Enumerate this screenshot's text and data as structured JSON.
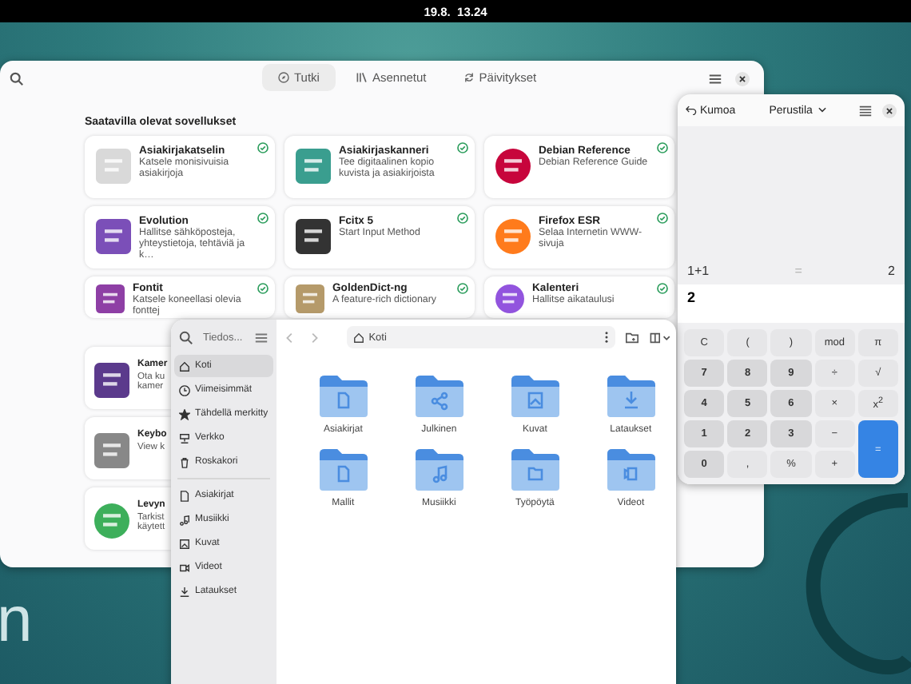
{
  "top_bar": {
    "clock": "19.8.  13.24"
  },
  "wallpaper": {
    "text": "n"
  },
  "software": {
    "tabs": [
      {
        "label": "Tutki",
        "selected": true
      },
      {
        "label": "Asennetut",
        "selected": false
      },
      {
        "label": "Päivitykset",
        "selected": false
      }
    ],
    "section_title": "Saatavilla olevat sovellukset",
    "apps": [
      {
        "name": "Asiakirjakatselin",
        "description": "Katsele monisivuisia asiakirjoja",
        "installed": true
      },
      {
        "name": "Asiakirjaskanneri",
        "description": "Tee digitaalinen kopio kuvista ja asiakirjoista",
        "installed": true
      },
      {
        "name": "Debian Reference",
        "description": "Debian Reference Guide",
        "installed": true
      },
      {
        "name": "Evolution",
        "description": "Hallitse sähköposteja, yhteystietoja, tehtäviä ja k…",
        "installed": true
      },
      {
        "name": "Fcitx 5",
        "description": "Start Input Method",
        "installed": true
      },
      {
        "name": "Firefox ESR",
        "description": "Selaa Internetin WWW-sivuja",
        "installed": true
      },
      {
        "name": "Fontit",
        "description": "Katsele koneellasi olevia fonttej",
        "installed": true
      },
      {
        "name": "GoldenDict-ng",
        "description": "A feature-rich dictionary",
        "installed": true
      },
      {
        "name": "Kalenteri",
        "description": "Hallitse aikataulusi",
        "installed": true
      },
      {
        "name": "Kamer",
        "description": "Ota ku kamer"
      },
      {
        "name": "Keybo",
        "description": "View k"
      },
      {
        "name": "Levyn",
        "description": "Tarkist käytett"
      }
    ]
  },
  "calculator": {
    "undo": "Kumoa",
    "mode": "Perustila",
    "history": {
      "expression": "1+1",
      "equals": "=",
      "result": "2"
    },
    "input": "2",
    "keys": [
      {
        "label": "C",
        "kind": "op"
      },
      {
        "label": "(",
        "kind": "op"
      },
      {
        "label": ")",
        "kind": "op"
      },
      {
        "label": "mod",
        "kind": "op"
      },
      {
        "label": "π",
        "kind": "op"
      },
      {
        "label": "7",
        "kind": "digit"
      },
      {
        "label": "8",
        "kind": "digit"
      },
      {
        "label": "9",
        "kind": "digit"
      },
      {
        "label": "÷",
        "kind": "op"
      },
      {
        "label": "√",
        "kind": "op"
      },
      {
        "label": "4",
        "kind": "digit"
      },
      {
        "label": "5",
        "kind": "digit"
      },
      {
        "label": "6",
        "kind": "digit"
      },
      {
        "label": "×",
        "kind": "op"
      },
      {
        "label": "x$^{2}$",
        "kind": "op"
      },
      {
        "label": "1",
        "kind": "digit"
      },
      {
        "label": "2",
        "kind": "digit"
      },
      {
        "label": "3",
        "kind": "digit"
      },
      {
        "label": "−",
        "kind": "op"
      },
      {
        "label": "=",
        "kind": "equals"
      },
      {
        "label": "0",
        "kind": "digit"
      },
      {
        "label": ",",
        "kind": "op"
      },
      {
        "label": "%",
        "kind": "op"
      },
      {
        "label": "+",
        "kind": "op"
      }
    ]
  },
  "files": {
    "sidebar_title": "Tiedos...",
    "places": [
      {
        "label": "Koti",
        "selected": true
      },
      {
        "label": "Viimeisimmät",
        "selected": false
      },
      {
        "label": "Tähdellä merkitty",
        "selected": false
      },
      {
        "label": "Verkko",
        "selected": false
      },
      {
        "label": "Roskakori",
        "selected": false
      }
    ],
    "bookmarks": [
      {
        "label": "Asiakirjat",
        "selected": false
      },
      {
        "label": "Musiikki",
        "selected": false
      },
      {
        "label": "Kuvat",
        "selected": false
      },
      {
        "label": "Videot",
        "selected": false
      },
      {
        "label": "Lataukset",
        "selected": false
      }
    ],
    "path": "Koti",
    "folders": [
      "Asiakirjat",
      "Julkinen",
      "Kuvat",
      "Lataukset",
      "Mallit",
      "Musiikki",
      "Työpöytä",
      "Videot"
    ]
  }
}
